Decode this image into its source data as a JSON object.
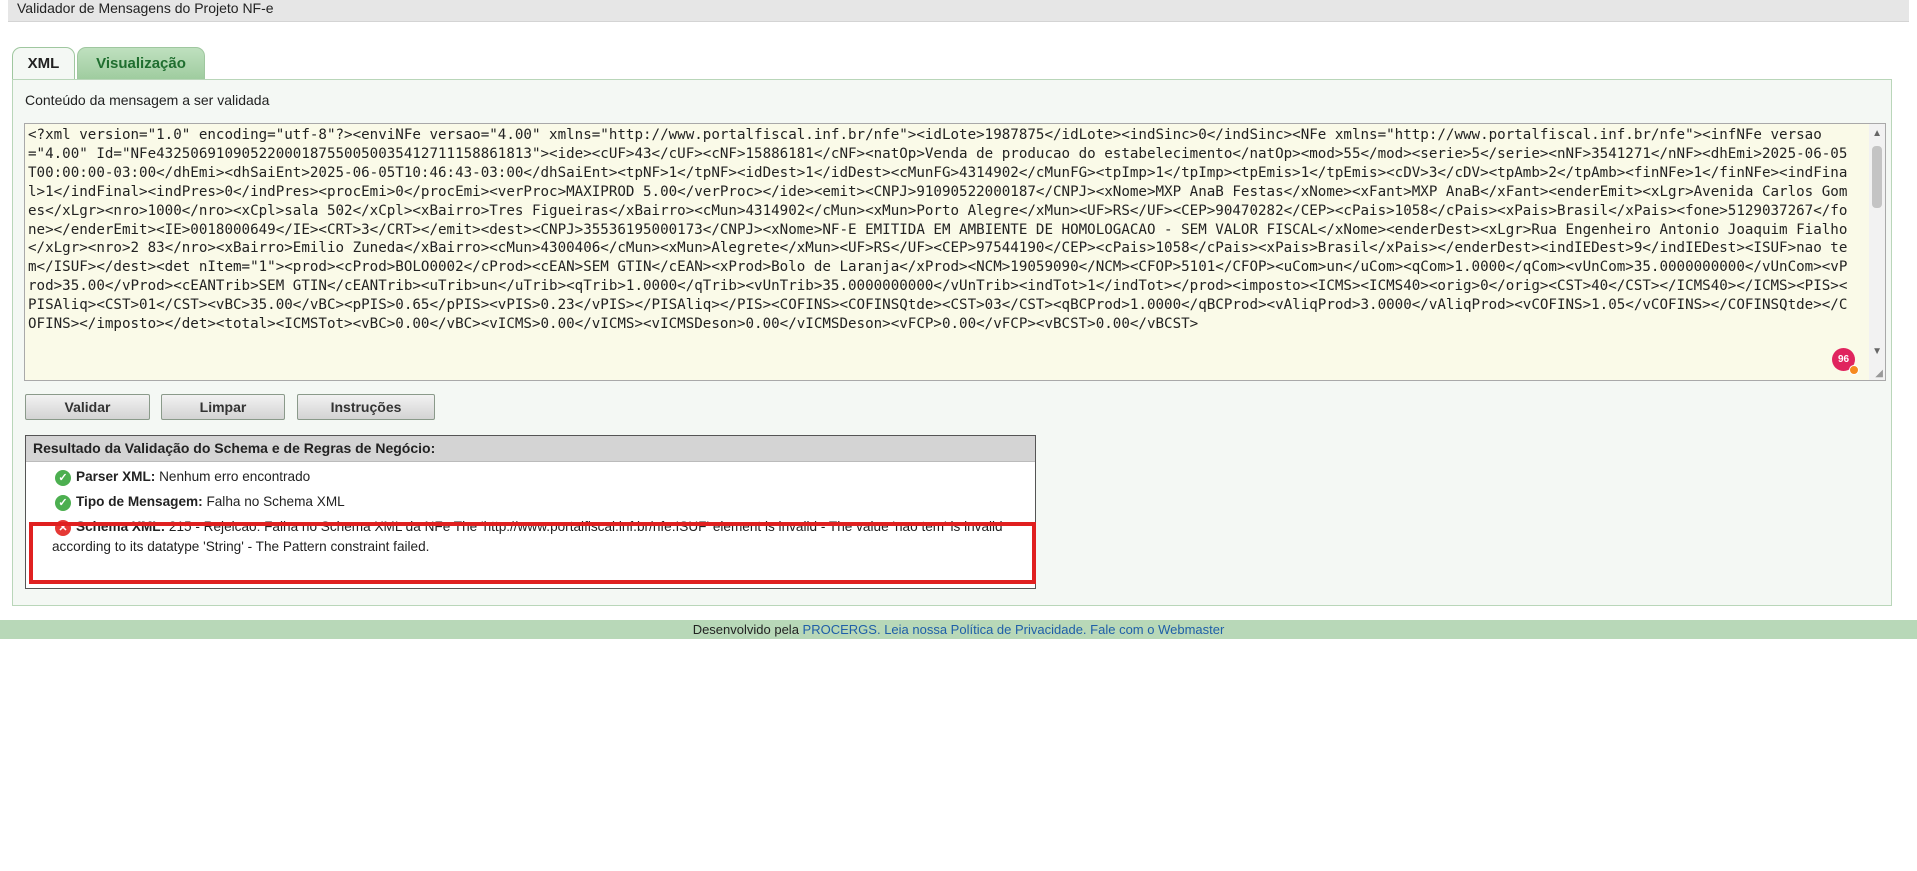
{
  "window": {
    "title": "Validador de Mensagens do Projeto NF-e"
  },
  "tabs": [
    {
      "label": "XML",
      "active": true
    },
    {
      "label": "Visualização",
      "active": false
    }
  ],
  "panel": {
    "title": "Conteúdo da mensagem a ser validada",
    "xml_content": "<?xml version=\"1.0\" encoding=\"utf-8\"?><enviNFe versao=\"4.00\" xmlns=\"http://www.portalfiscal.inf.br/nfe\"><idLote>1987875</idLote><indSinc>0</indSinc><NFe xmlns=\"http://www.portalfiscal.inf.br/nfe\"><infNFe versao=\"4.00\" Id=\"NFe43250691090522000187550050035412711158861813\"><ide><cUF>43</cUF><cNF>15886181</cNF><natOp>Venda de producao do estabelecimento</natOp><mod>55</mod><serie>5</serie><nNF>3541271</nNF><dhEmi>2025-06-05T00:00:00-03:00</dhEmi><dhSaiEnt>2025-06-05T10:46:43-03:00</dhSaiEnt><tpNF>1</tpNF><idDest>1</idDest><cMunFG>4314902</cMunFG><tpImp>1</tpImp><tpEmis>1</tpEmis><cDV>3</cDV><tpAmb>2</tpAmb><finNFe>1</finNFe><indFinal>1</indFinal><indPres>0</indPres><procEmi>0</procEmi><verProc>MAXIPROD 5.00</verProc></ide><emit><CNPJ>91090522000187</CNPJ><xNome>MXP AnaB Festas</xNome><xFant>MXP AnaB</xFant><enderEmit><xLgr>Avenida Carlos Gomes</xLgr><nro>1000</nro><xCpl>sala 502</xCpl><xBairro>Tres Figueiras</xBairro><cMun>4314902</cMun><xMun>Porto Alegre</xMun><UF>RS</UF><CEP>90470282</CEP><cPais>1058</cPais><xPais>Brasil</xPais><fone>5129037267</fone></enderEmit><IE>0018000649</IE><CRT>3</CRT></emit><dest><CNPJ>35536195000173</CNPJ><xNome>NF-E EMITIDA EM AMBIENTE DE HOMOLOGACAO - SEM VALOR FISCAL</xNome><enderDest><xLgr>Rua Engenheiro Antonio Joaquim Fialho</xLgr><nro>2 83</nro><xBairro>Emilio Zuneda</xBairro><cMun>4300406</cMun><xMun>Alegrete</xMun><UF>RS</UF><CEP>97544190</CEP><cPais>1058</cPais><xPais>Brasil</xPais></enderDest><indIEDest>9</indIEDest><ISUF>nao tem</ISUF></dest><det nItem=\"1\"><prod><cProd>BOLO0002</cProd><cEAN>SEM GTIN</cEAN><xProd>Bolo de Laranja</xProd><NCM>19059090</NCM><CFOP>5101</CFOP><uCom>un</uCom><qCom>1.0000</qCom><vUnCom>35.0000000000</vUnCom><vProd>35.00</vProd><cEANTrib>SEM GTIN</cEANTrib><uTrib>un</uTrib><qTrib>1.0000</qTrib><vUnTrib>35.0000000000</vUnTrib><indTot>1</indTot></prod><imposto><ICMS><ICMS40><orig>0</orig><CST>40</CST></ICMS40></ICMS><PIS><PISAliq><CST>01</CST><vBC>35.00</vBC><pPIS>0.65</pPIS><vPIS>0.23</vPIS></PISAliq></PIS><COFINS><COFINSQtde><CST>03</CST><qBCProd>1.0000</qBCProd><vAliqProd>3.0000</vAliqProd><vCOFINS>1.05</vCOFINS></COFINSQtde></COFINS></imposto></det><total><ICMSTot><vBC>0.00</vBC><vICMS>0.00</vICMS><vICMSDeson>0.00</vICMSDeson><vFCP>0.00</vFCP><vBCST>0.00</vBCST>",
    "notification_count": "96"
  },
  "buttons": {
    "validar": "Validar",
    "limpar": "Limpar",
    "instrucoes": "Instruções"
  },
  "result": {
    "header": "Resultado da Validação do Schema e de Regras de Negócio:",
    "parser_label": "Parser XML:",
    "parser_value": "Nenhum erro encontrado",
    "tipo_label": "Tipo de Mensagem:",
    "tipo_value": "Falha no Schema XML",
    "schema_label": "Schema XML:",
    "schema_value": "215 - Rejeicao: Falha no Schema XML da NFe The 'http://www.portalfiscal.inf.br/nfe:ISUF' element is invalid - The value 'nao tem' is invalid according to its datatype 'String' - The Pattern constraint failed."
  },
  "footer": {
    "prefix": "Desenvolvido pela",
    "link_procergs": "PROCERGS.",
    "link_privacy": "Leia nossa Política de Privacidade.",
    "link_webmaster": "Fale com o Webmaster"
  },
  "colors": {
    "accent_green": "#9fcc9f",
    "error_red": "#e02020",
    "link_blue": "#1f5fa8"
  }
}
